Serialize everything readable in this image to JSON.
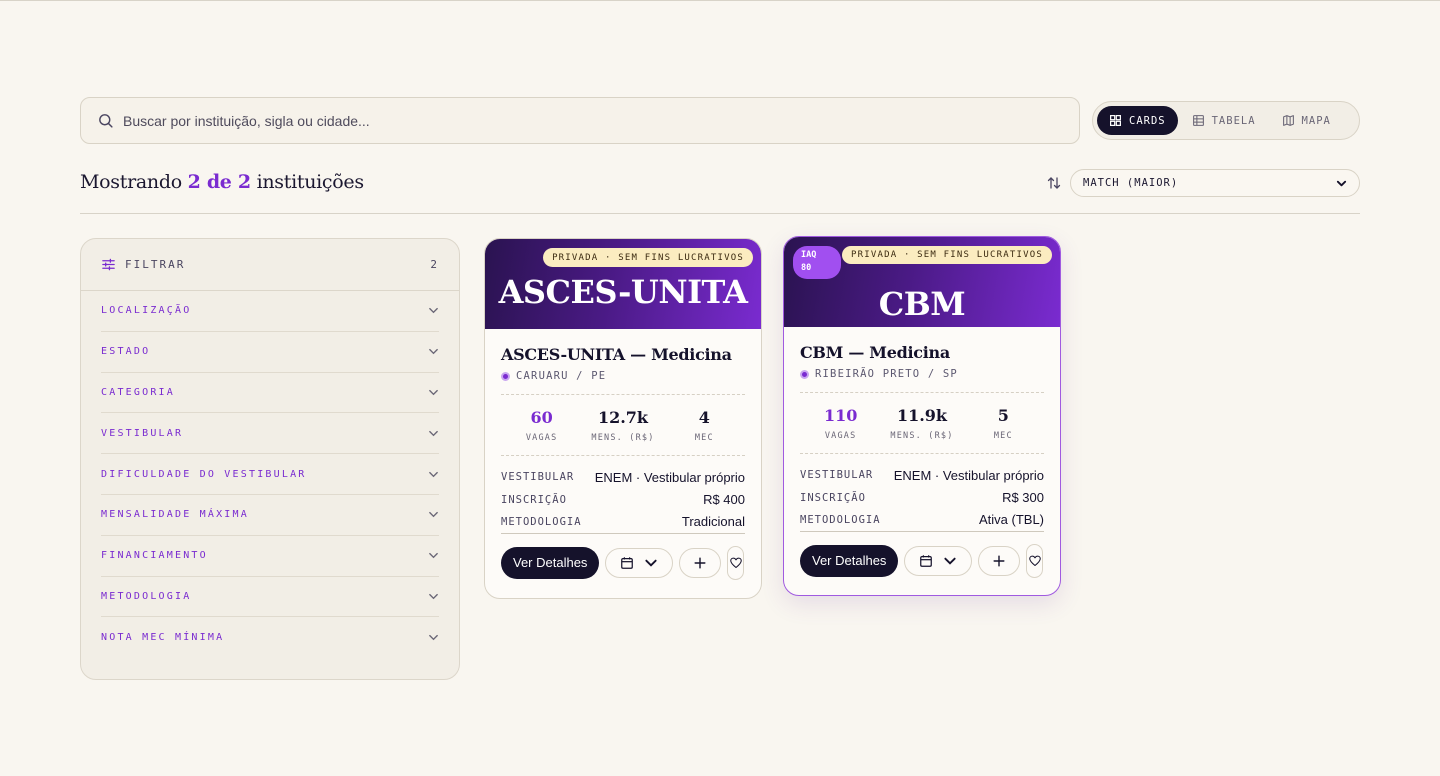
{
  "search": {
    "placeholder": "Buscar por instituição, sigla ou cidade..."
  },
  "view_toggle": [
    {
      "label": "CARDS",
      "icon": "grid-icon",
      "active": true
    },
    {
      "label": "TABELA",
      "icon": "table-icon",
      "active": false
    },
    {
      "label": "MAPA",
      "icon": "map-icon",
      "active": false
    }
  ],
  "results": {
    "prefix": "Mostrando",
    "count": "2 de 2",
    "suffix": "instituições"
  },
  "sort": {
    "selected": "MATCH (MAIOR)"
  },
  "filters": {
    "title": "FILTRAR",
    "active_count": "2",
    "items": [
      "LOCALIZAÇÃO",
      "ESTADO",
      "CATEGORIA",
      "VESTIBULAR",
      "DIFICULDADE DO VESTIBULAR",
      "MENSALIDADE MÁXIMA",
      "FINANCIAMENTO",
      "METODOLOGIA",
      "NOTA MEC MÍNIMA"
    ]
  },
  "cards": [
    {
      "badge": "PRIVADA · SEM FINS LUCRATIVOS",
      "banner_name": "ASCES-UNITA",
      "title": "ASCES-UNITA — Medicina",
      "location": "CARUARU / PE",
      "stats": [
        {
          "value": "60",
          "label": "VAGAS"
        },
        {
          "value": "12.7k",
          "label": "MENS. (R$)"
        },
        {
          "value": "4",
          "label": "MEC"
        }
      ],
      "rows": [
        {
          "key": "VESTIBULAR",
          "value": "ENEM · Vestibular próprio"
        },
        {
          "key": "INSCRIÇÃO",
          "value": "R$ 400"
        },
        {
          "key": "METODOLOGIA",
          "value": "Tradicional"
        }
      ],
      "cta": "Ver Detalhes"
    },
    {
      "iaq": "IAQ 80",
      "iaq_line1": "IAQ",
      "iaq_line2": "80",
      "badge": "PRIVADA · SEM FINS LUCRATIVOS",
      "banner_name": "CBM",
      "title": "CBM — Medicina",
      "location": "RIBEIRÃO PRETO / SP",
      "stats": [
        {
          "value": "110",
          "label": "VAGAS"
        },
        {
          "value": "11.9k",
          "label": "MENS. (R$)"
        },
        {
          "value": "5",
          "label": "MEC"
        }
      ],
      "rows": [
        {
          "key": "VESTIBULAR",
          "value": "ENEM · Vestibular próprio"
        },
        {
          "key": "INSCRIÇÃO",
          "value": "R$ 300"
        },
        {
          "key": "METODOLOGIA",
          "value": "Ativa (TBL)"
        }
      ],
      "cta": "Ver Detalhes"
    }
  ],
  "colors": {
    "accent": "#7a2bd0",
    "dark": "#15122b",
    "background": "#f9f6f0",
    "badge": "#fbecc0"
  }
}
